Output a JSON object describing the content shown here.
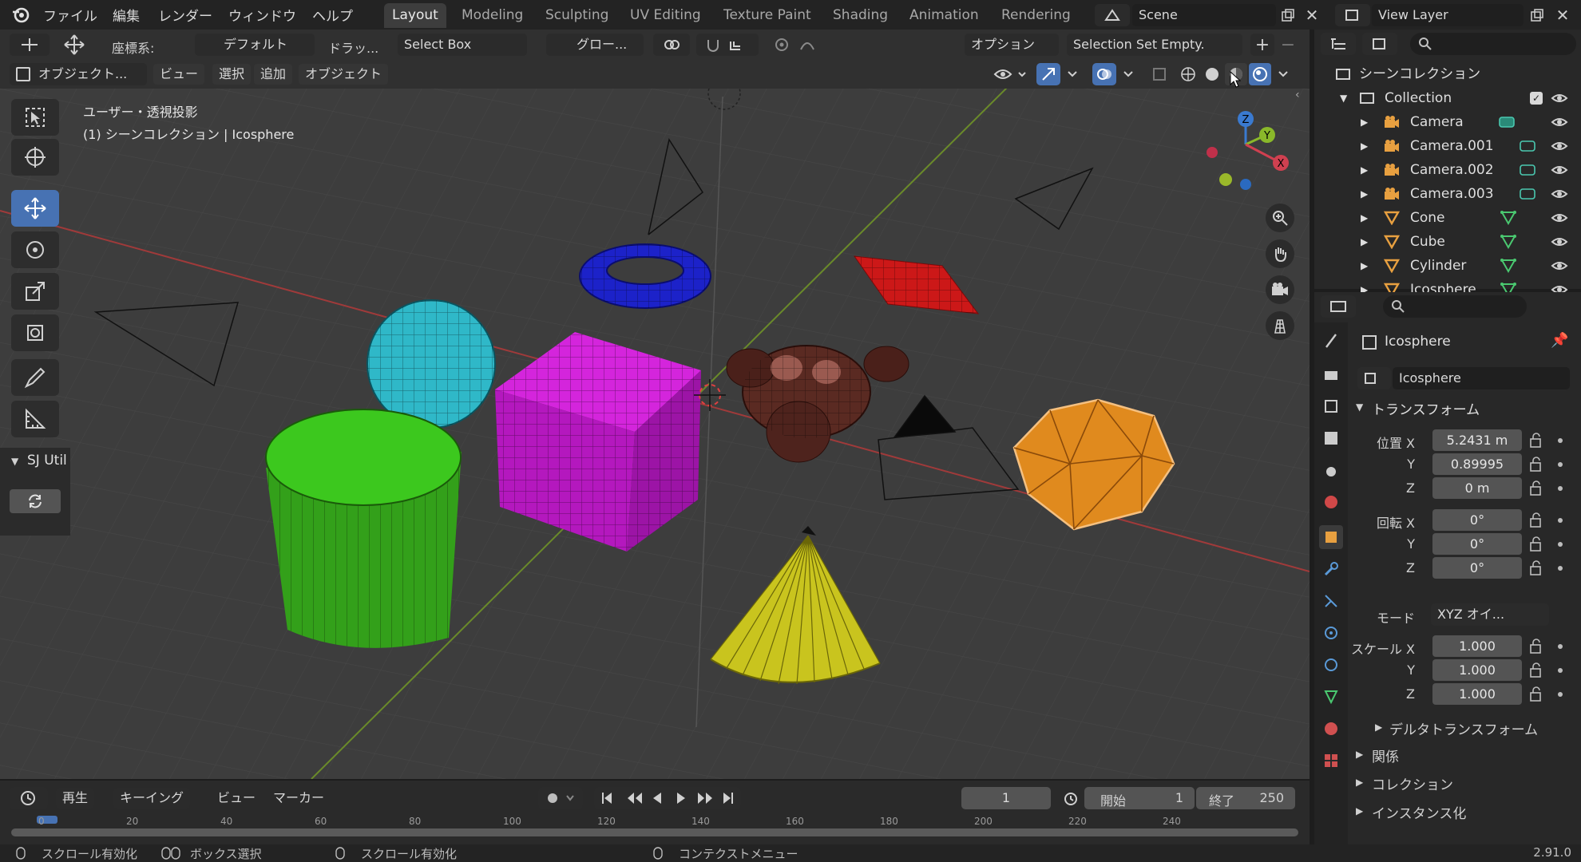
{
  "topbar": {
    "menus": [
      "ファイル",
      "編集",
      "レンダー",
      "ウィンドウ",
      "ヘルプ"
    ],
    "workspaces": [
      "Layout",
      "Modeling",
      "Sculpting",
      "UV Editing",
      "Texture Paint",
      "Shading",
      "Animation",
      "Rendering"
    ],
    "active_workspace": "Layout",
    "scene_name": "Scene",
    "view_layer": "View Layer"
  },
  "tool_header": {
    "coord_label": "座標系:",
    "orientation": "デフォルト",
    "drag_label": "ドラッ...",
    "drag_value": "Select Box",
    "transform_orientation": "グロー...",
    "options_label": "オプション",
    "selection_set": "Selection Set Empty."
  },
  "view_header": {
    "mode": "オブジェクト...",
    "menus": [
      "ビュー",
      "選択",
      "追加",
      "オブジェクト"
    ]
  },
  "viewport": {
    "view_name": "ユーザー・透視投影",
    "collection_info": "(1) シーンコレクション | Icosphere",
    "addon_panel": "SJ Util",
    "gizmo_axes": [
      "Z",
      "Y",
      "X"
    ]
  },
  "outliner": {
    "root": "シーンコレクション",
    "collection": "Collection",
    "items": [
      {
        "name": "Camera",
        "type": "camera"
      },
      {
        "name": "Camera.001",
        "type": "camera"
      },
      {
        "name": "Camera.002",
        "type": "camera"
      },
      {
        "name": "Camera.003",
        "type": "camera"
      },
      {
        "name": "Cone",
        "type": "mesh"
      },
      {
        "name": "Cube",
        "type": "mesh"
      },
      {
        "name": "Cylinder",
        "type": "mesh"
      },
      {
        "name": "Icosphere",
        "type": "mesh"
      }
    ]
  },
  "properties": {
    "object_name": "Icosphere",
    "object_name_field": "Icosphere",
    "transform_title": "トランスフォーム",
    "location_label": "位置 X",
    "location": [
      "5.2431 m",
      "0.89995",
      "0 m"
    ],
    "rotation_label": "回転 X",
    "rotation": [
      "0°",
      "0°",
      "0°"
    ],
    "mode_label": "モード",
    "mode_value": "XYZ オイ...",
    "scale_label": "スケール X",
    "scale": [
      "1.000",
      "1.000",
      "1.000"
    ],
    "axis_y": "Y",
    "axis_z": "Z",
    "sections": [
      "デルタトランスフォーム",
      "関係",
      "コレクション",
      "インスタンス化"
    ]
  },
  "timeline": {
    "menus": [
      "再生",
      "キーイング",
      "ビュー",
      "マーカー"
    ],
    "current_frame": "1",
    "start_label": "開始",
    "start_value": "1",
    "end_label": "終了",
    "end_value": "250",
    "ruler_ticks": [
      "0",
      "20",
      "40",
      "60",
      "80",
      "100",
      "120",
      "140",
      "160",
      "180",
      "200",
      "220",
      "240"
    ]
  },
  "statusbar": {
    "hint1": "スクロール有効化",
    "hint2": "ボックス選択",
    "hint3": "スクロール有効化",
    "hint4": "コンテクストメニュー",
    "version": "2.91.0"
  },
  "colors": {
    "accent": "#4772b3",
    "torus": "#1c22c9",
    "sphere": "#2fb8c8",
    "cube": "#c21ccc",
    "cylinder": "#3cba1e",
    "cone": "#c9c41e",
    "plane": "#cc1818",
    "monkey": "#5a2a22",
    "icosphere": "#e08a1e"
  }
}
